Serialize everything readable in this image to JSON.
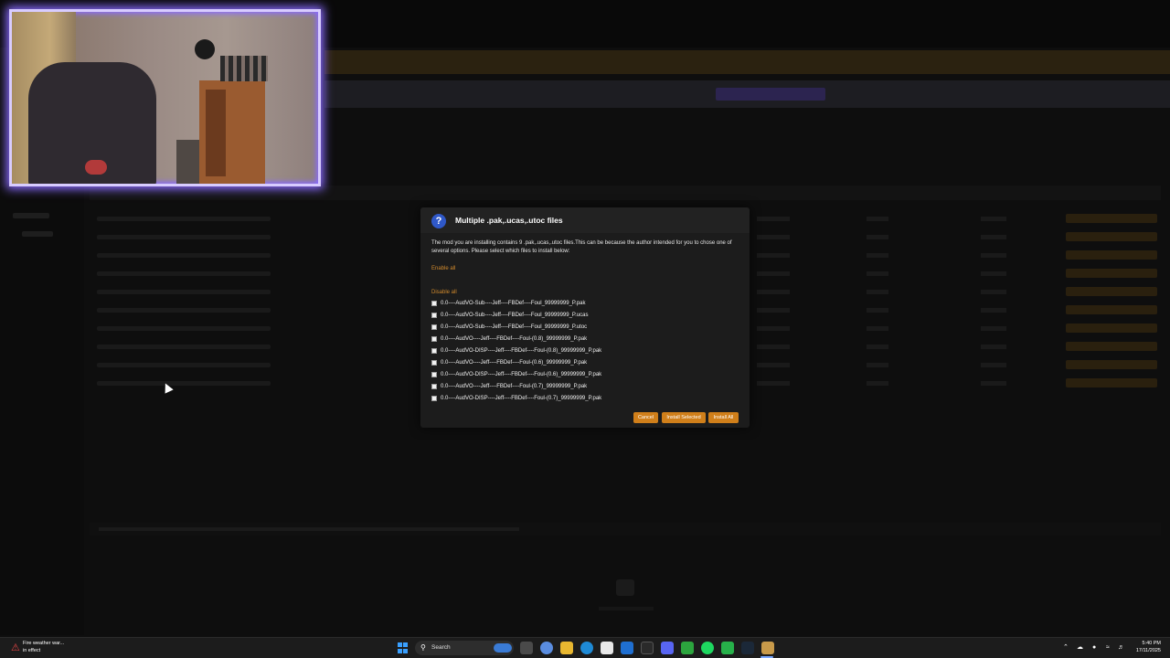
{
  "modal": {
    "icon": "?",
    "title": "Multiple .pak,.ucas,.utoc files",
    "description": "The mod you are installing contains 9 .pak,.ucas,.utoc files.This can be because the author intended for you to chose one of several options. Please select which files to install below:",
    "enable_all": "Enable all",
    "disable_all": "Disable all",
    "files": [
      "0.0----AudVO-Sub----Jeff----FBDef----Foul_99999999_P.pak",
      "0.0----AudVO-Sub----Jeff----FBDef----Foul_99999999_P.ucas",
      "0.0----AudVO-Sub----Jeff----FBDef----Foul_99999999_P.utoc",
      "0.0----AudVO----Jeff----FBDef----Foul-(0.8)_99999999_P.pak",
      "0.0----AudVO-DISP----Jeff----FBDef----Foul-(0.8)_99999999_P.pak",
      "0.0----AudVO----Jeff----FBDef----Foul-(0.6)_99999999_P.pak",
      "0.0----AudVO-DISP----Jeff----FBDef----Foul-(0.6)_99999999_P.pak",
      "0.0----AudVO----Jeff----FBDef----Foul-(0.7)_99999999_P.pak",
      "0.0----AudVO-DISP----Jeff----FBDef----Foul-(0.7)_99999999_P.pak"
    ],
    "buttons": {
      "cancel": "Cancel",
      "install_selected": "Install Selected",
      "install_all": "Install All"
    },
    "accent_color": "#d07f1a"
  },
  "taskbar": {
    "weather_title": "Fire weather war...",
    "weather_sub": "in effect",
    "search_label": "Search",
    "time": "5:40 PM",
    "date": "17/11/2025"
  }
}
